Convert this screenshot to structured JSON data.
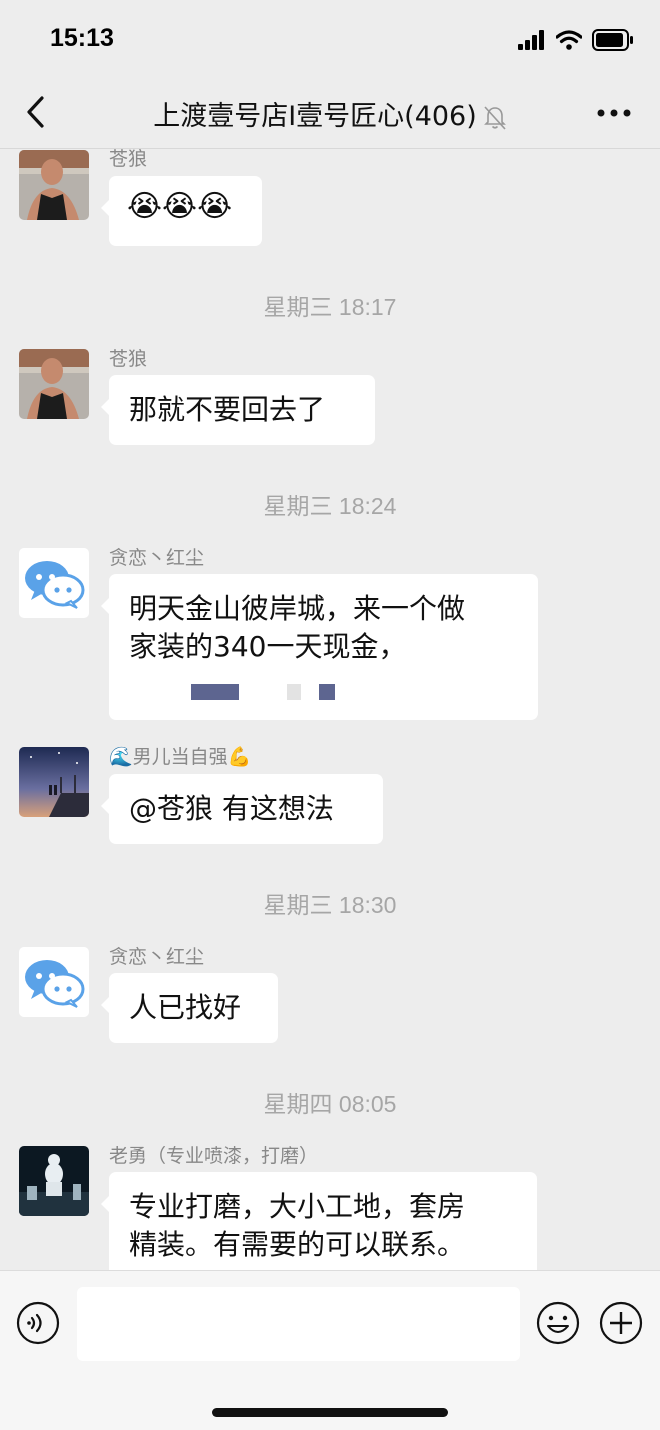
{
  "status_bar": {
    "time": "15:13"
  },
  "header": {
    "title": "上渡壹号店I壹号匠心(406)"
  },
  "messages": [
    {
      "sender": "苍狼",
      "text": "😭😭😭"
    },
    {
      "timestamp": "星期三 18:17"
    },
    {
      "sender": "苍狼",
      "text": "那就不要回去了"
    },
    {
      "timestamp": "星期三 18:24"
    },
    {
      "sender": "贪恋丶红尘",
      "line1": "明天金山彼岸城，来一个做",
      "line2": "家装的340一天现金，"
    },
    {
      "sender": "🌊男儿当自强💪",
      "text": "@苍狼 有这想法"
    },
    {
      "timestamp": "星期三 18:30"
    },
    {
      "sender": "贪恋丶红尘",
      "text": "人已找好"
    },
    {
      "timestamp": "星期四 08:05"
    },
    {
      "sender": "老勇（专业喷漆，打磨）",
      "line1": "专业打磨，大小工地，套房",
      "line2": "精装。有需要的可以联系。"
    }
  ],
  "colors": {
    "background": "#ededed",
    "bubble": "#ffffff",
    "sender": "#888888",
    "timestamp": "#a6a6a6"
  }
}
